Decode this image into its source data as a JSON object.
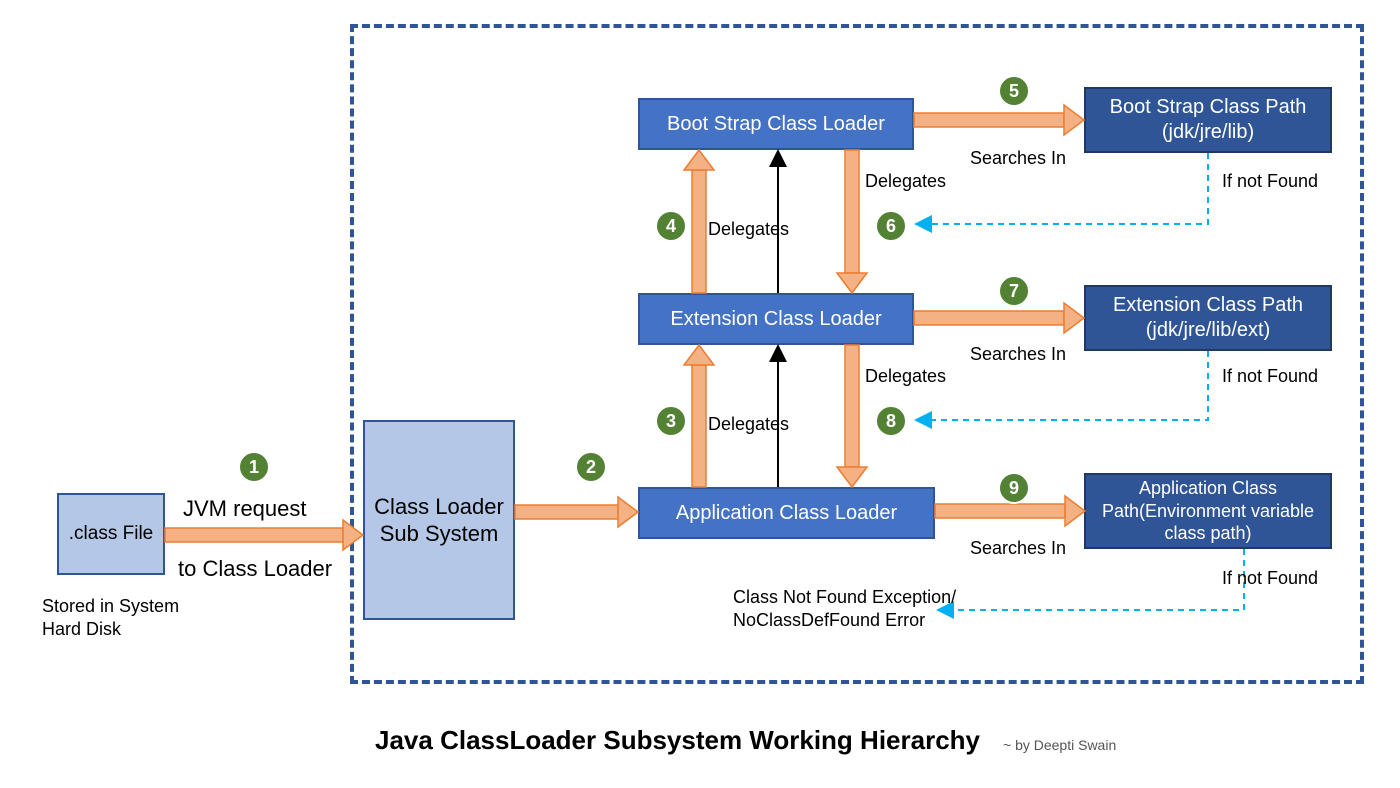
{
  "title": "Java ClassLoader Subsystem Working Hierarchy",
  "byline": "~ by Deepti Swain",
  "boxes": {
    "classFile": ".class File",
    "storedNote": "Stored in System\nHard Disk",
    "classLoaderSubsystem": "Class Loader Sub System",
    "bootstrap": "Boot Strap Class Loader",
    "extension": "Extension Class Loader",
    "application": "Application Class Loader",
    "bootPath": "Boot Strap Class Path\n(jdk/jre/lib)",
    "extPath": "Extension Class Path\n(jdk/jre/lib/ext)",
    "appPath": "Application Class Path(Environment variable class path)"
  },
  "labels": {
    "jvmRequest": "JVM request",
    "toClassLoader": "to Class Loader",
    "delegates34": "Delegates",
    "delegates6": "Delegates",
    "delegates8": "Delegates",
    "searchesIn5": "Searches In",
    "searchesIn7": "Searches In",
    "searchesIn9": "Searches In",
    "ifNotFound1": "If not Found",
    "ifNotFound2": "If not Found",
    "ifNotFound3": "If not Found",
    "classNotFound": "Class Not Found Exception/\nNoClassDefFound Error"
  },
  "badges": {
    "b1": "1",
    "b2": "2",
    "b3": "3",
    "b4": "4",
    "b5": "5",
    "b6": "6",
    "b7": "7",
    "b8": "8",
    "b9": "9"
  }
}
